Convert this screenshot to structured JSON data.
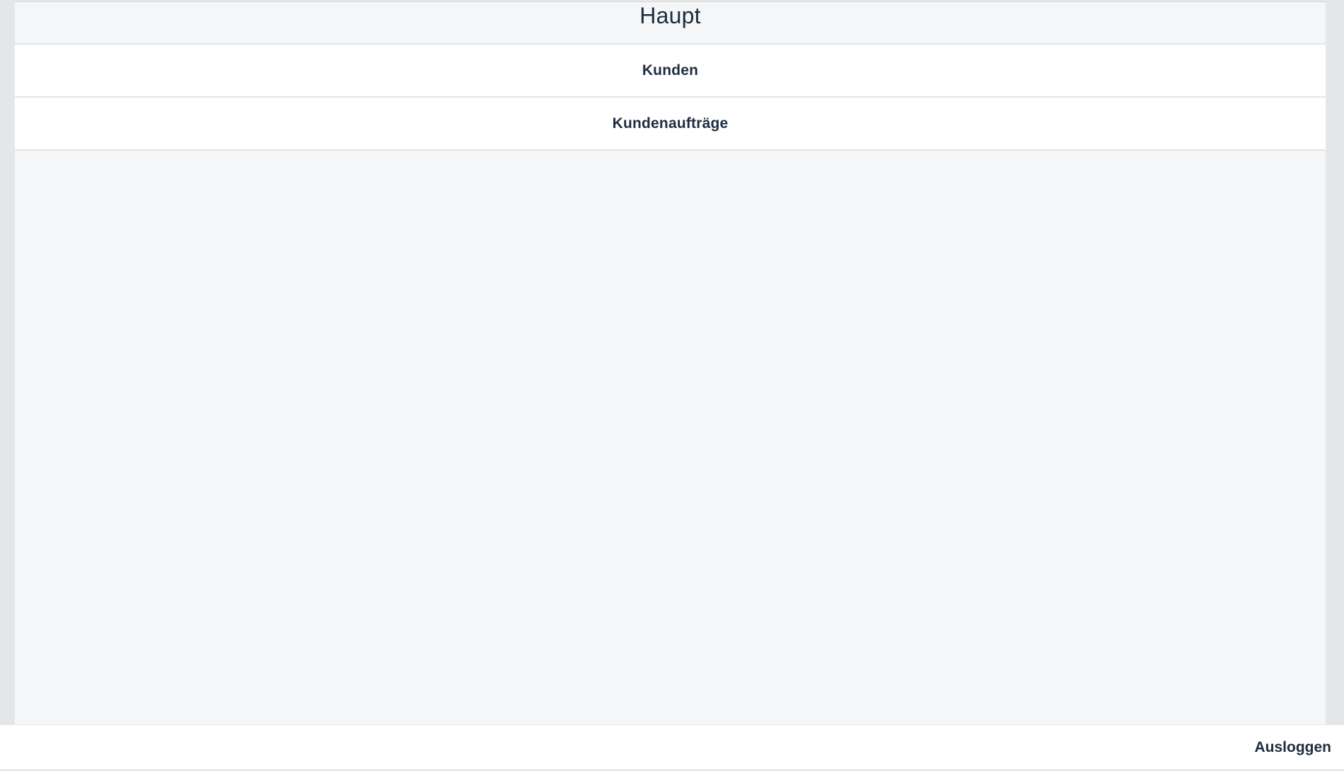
{
  "page": {
    "title": "Haupt"
  },
  "nav": {
    "items": [
      {
        "label": "Kunden"
      },
      {
        "label": "Kundenaufträge"
      }
    ]
  },
  "footer": {
    "logout_label": "Ausloggen"
  },
  "colors": {
    "text": "#1d2d3e",
    "background": "#f5f6f7",
    "item_background": "#ffffff"
  }
}
